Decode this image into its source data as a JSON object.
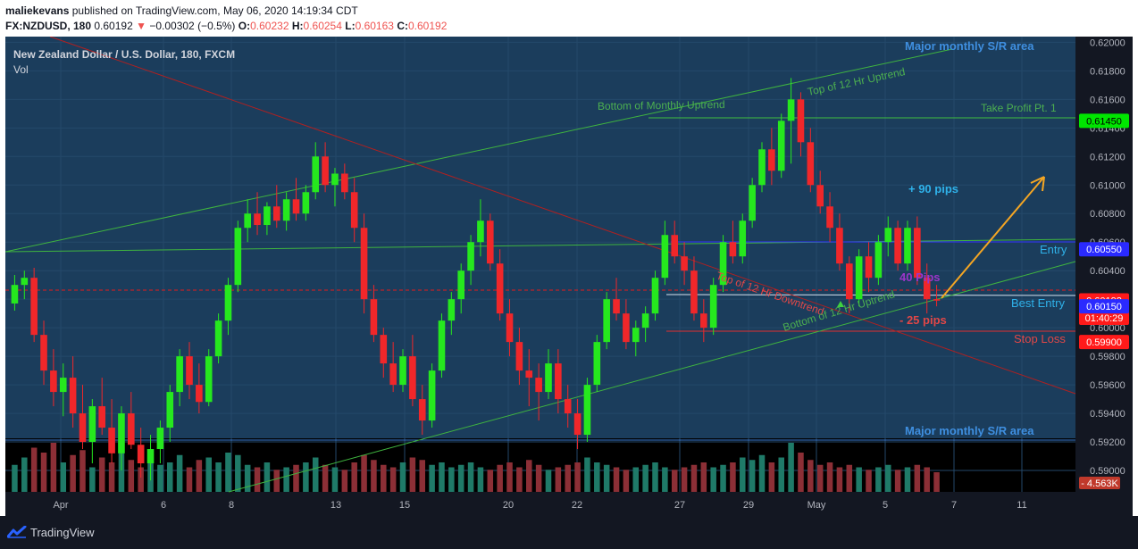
{
  "header": {
    "author": "maliekevans",
    "published_text": "published on TradingView.com, May 06, 2020 14:19:34 CDT",
    "symbol": "FX:NZDUSD, 180",
    "last": "0.60192",
    "arrow": "▼",
    "change": "−0.00302 (−0.5%)",
    "o_label": "O:",
    "o_value": "0.60232",
    "h_label": "H:",
    "h_value": "0.60254",
    "l_label": "L:",
    "l_value": "0.60163",
    "c_label": "C:",
    "c_value": "0.60192"
  },
  "legend": {
    "title": "New Zealand Dollar / U.S. Dollar, 180, FXCM",
    "vol": "Vol"
  },
  "footer": {
    "brand": "TradingView"
  },
  "chart_data": {
    "type": "candlestick",
    "title": "New Zealand Dollar / U.S. Dollar, 180, FXCM",
    "y_ticks": [
      "0.62000",
      "0.61800",
      "0.61600",
      "0.61400",
      "0.61200",
      "0.61000",
      "0.60800",
      "0.60600",
      "0.60400",
      "0.60200",
      "0.60000",
      "0.59800",
      "0.59600",
      "0.59400",
      "0.59200",
      "0.59000"
    ],
    "x_ticks": [
      "Apr",
      "6",
      "8",
      "13",
      "15",
      "20",
      "22",
      "27",
      "29",
      "May",
      "5",
      "7",
      "11"
    ],
    "ylim": [
      0.5885,
      0.6204
    ],
    "price_labels": [
      {
        "text": "0.61450",
        "value": 0.6145,
        "bg": "#00e600",
        "fg": "#000000"
      },
      {
        "text": "0.60550",
        "value": 0.6055,
        "bg": "#2a2aff",
        "fg": "#ffffff"
      },
      {
        "text": "0.60192",
        "value": 0.60192,
        "bg": "#ff1a1a",
        "fg": "#ffffff"
      },
      {
        "text": "01:40:29",
        "value": 0.6007,
        "bg": "#ff1a1a",
        "fg": "#ffffff"
      },
      {
        "text": "0.60150",
        "value": 0.6015,
        "bg": "#2a2aff",
        "fg": "#ffffff"
      },
      {
        "text": "0.59900",
        "value": 0.599,
        "bg": "#ff1a1a",
        "fg": "#ffffff"
      }
    ],
    "volume_label": "4.563K",
    "annotations": {
      "sr_top": "Major monthly S/R area",
      "sr_bottom": "Major monthly S/R area",
      "top_12hr": "Top of 12 Hr Uptrend",
      "bottom_monthly": "Bottom of Monthly Uptrend",
      "take_profit": "Take Profit Pt. 1",
      "plus_90": "+ 90 pips",
      "entry": "Entry",
      "pips40": "40 Pips",
      "top_downtrend": "Top of 12 Hr Downtrend",
      "bottom_12hr": "Bottom of 12 Hr Uptrend",
      "best_entry": "Best Entry",
      "minus_25": "- 25 pips",
      "stop_loss": "Stop Loss"
    },
    "levels": {
      "take_profit": 0.6145,
      "entry": 0.6055,
      "last": 0.60192,
      "best_entry": 0.6015,
      "stop_loss": 0.599,
      "sr_area_bottom": 0.5911
    },
    "candles": [
      [
        0.6017,
        0.6037,
        0.6012,
        0.603
      ],
      [
        0.603,
        0.604,
        0.602,
        0.6035
      ],
      [
        0.6035,
        0.6042,
        0.599,
        0.5995
      ],
      [
        0.5995,
        0.6005,
        0.596,
        0.597
      ],
      [
        0.597,
        0.5985,
        0.5945,
        0.5955
      ],
      [
        0.5955,
        0.5975,
        0.5938,
        0.5965
      ],
      [
        0.5965,
        0.598,
        0.593,
        0.594
      ],
      [
        0.594,
        0.596,
        0.5915,
        0.592
      ],
      [
        0.592,
        0.595,
        0.5905,
        0.5945
      ],
      [
        0.5945,
        0.5965,
        0.5925,
        0.593
      ],
      [
        0.593,
        0.595,
        0.5905,
        0.5912
      ],
      [
        0.5912,
        0.5945,
        0.59,
        0.594
      ],
      [
        0.594,
        0.5955,
        0.5915,
        0.5918
      ],
      [
        0.5918,
        0.593,
        0.5895,
        0.5905
      ],
      [
        0.5905,
        0.5925,
        0.5893,
        0.5915
      ],
      [
        0.5915,
        0.5935,
        0.5905,
        0.593
      ],
      [
        0.593,
        0.596,
        0.592,
        0.5955
      ],
      [
        0.5955,
        0.5985,
        0.5945,
        0.598
      ],
      [
        0.598,
        0.599,
        0.595,
        0.596
      ],
      [
        0.596,
        0.5975,
        0.594,
        0.5948
      ],
      [
        0.5948,
        0.5985,
        0.5945,
        0.598
      ],
      [
        0.598,
        0.601,
        0.5975,
        0.6005
      ],
      [
        0.6005,
        0.6035,
        0.5995,
        0.603
      ],
      [
        0.603,
        0.6075,
        0.6025,
        0.607
      ],
      [
        0.607,
        0.609,
        0.606,
        0.608
      ],
      [
        0.608,
        0.6095,
        0.6065,
        0.6072
      ],
      [
        0.6072,
        0.6088,
        0.6065,
        0.6085
      ],
      [
        0.6085,
        0.61,
        0.607,
        0.6075
      ],
      [
        0.6075,
        0.6095,
        0.6068,
        0.609
      ],
      [
        0.609,
        0.6105,
        0.6075,
        0.608
      ],
      [
        0.608,
        0.61,
        0.6075,
        0.6095
      ],
      [
        0.6095,
        0.613,
        0.609,
        0.612
      ],
      [
        0.612,
        0.613,
        0.6095,
        0.61
      ],
      [
        0.61,
        0.6112,
        0.6085,
        0.6108
      ],
      [
        0.6108,
        0.6115,
        0.609,
        0.6095
      ],
      [
        0.6095,
        0.6105,
        0.606,
        0.607
      ],
      [
        0.607,
        0.608,
        0.601,
        0.602
      ],
      [
        0.602,
        0.603,
        0.599,
        0.5995
      ],
      [
        0.5995,
        0.6,
        0.5965,
        0.5975
      ],
      [
        0.5975,
        0.599,
        0.5955,
        0.596
      ],
      [
        0.596,
        0.5985,
        0.5955,
        0.598
      ],
      [
        0.598,
        0.5995,
        0.5945,
        0.595
      ],
      [
        0.595,
        0.596,
        0.5925,
        0.5935
      ],
      [
        0.5935,
        0.5975,
        0.593,
        0.597
      ],
      [
        0.597,
        0.601,
        0.5965,
        0.6005
      ],
      [
        0.6005,
        0.6025,
        0.5995,
        0.602
      ],
      [
        0.602,
        0.6045,
        0.601,
        0.604
      ],
      [
        0.604,
        0.6065,
        0.603,
        0.606
      ],
      [
        0.606,
        0.609,
        0.605,
        0.6075
      ],
      [
        0.6075,
        0.608,
        0.604,
        0.6045
      ],
      [
        0.6045,
        0.6055,
        0.6005,
        0.601
      ],
      [
        0.601,
        0.602,
        0.598,
        0.599
      ],
      [
        0.599,
        0.6,
        0.596,
        0.597
      ],
      [
        0.597,
        0.5985,
        0.5945,
        0.5965
      ],
      [
        0.5965,
        0.5975,
        0.5935,
        0.5955
      ],
      [
        0.5955,
        0.5985,
        0.595,
        0.5975
      ],
      [
        0.5975,
        0.5985,
        0.594,
        0.595
      ],
      [
        0.595,
        0.596,
        0.593,
        0.594
      ],
      [
        0.594,
        0.595,
        0.5915,
        0.5925
      ],
      [
        0.5925,
        0.5965,
        0.592,
        0.596
      ],
      [
        0.596,
        0.5995,
        0.5955,
        0.599
      ],
      [
        0.599,
        0.6025,
        0.5985,
        0.602
      ],
      [
        0.602,
        0.6035,
        0.6005,
        0.601
      ],
      [
        0.601,
        0.602,
        0.5985,
        0.599
      ],
      [
        0.599,
        0.6005,
        0.598,
        0.6
      ],
      [
        0.6,
        0.6015,
        0.599,
        0.601
      ],
      [
        0.601,
        0.604,
        0.6005,
        0.6035
      ],
      [
        0.6035,
        0.6075,
        0.603,
        0.6065
      ],
      [
        0.6065,
        0.6075,
        0.6045,
        0.605
      ],
      [
        0.605,
        0.606,
        0.603,
        0.604
      ],
      [
        0.604,
        0.605,
        0.6005,
        0.601
      ],
      [
        0.601,
        0.602,
        0.599,
        0.6
      ],
      [
        0.6,
        0.6035,
        0.5995,
        0.603
      ],
      [
        0.603,
        0.6065,
        0.6025,
        0.606
      ],
      [
        0.606,
        0.6075,
        0.6045,
        0.605
      ],
      [
        0.605,
        0.608,
        0.6045,
        0.6075
      ],
      [
        0.6075,
        0.6105,
        0.607,
        0.61
      ],
      [
        0.61,
        0.613,
        0.6095,
        0.6125
      ],
      [
        0.6125,
        0.614,
        0.61,
        0.611
      ],
      [
        0.611,
        0.615,
        0.6105,
        0.6145
      ],
      [
        0.6145,
        0.6175,
        0.6115,
        0.616
      ],
      [
        0.616,
        0.6165,
        0.612,
        0.613
      ],
      [
        0.613,
        0.614,
        0.6095,
        0.61
      ],
      [
        0.61,
        0.611,
        0.608,
        0.6085
      ],
      [
        0.6085,
        0.6095,
        0.606,
        0.607
      ],
      [
        0.607,
        0.608,
        0.604,
        0.6045
      ],
      [
        0.6045,
        0.605,
        0.601,
        0.602
      ],
      [
        0.602,
        0.6055,
        0.6015,
        0.605
      ],
      [
        0.605,
        0.606,
        0.6025,
        0.6035
      ],
      [
        0.6035,
        0.6065,
        0.603,
        0.606
      ],
      [
        0.606,
        0.6078,
        0.605,
        0.607
      ],
      [
        0.607,
        0.6075,
        0.604,
        0.6045
      ],
      [
        0.6045,
        0.6075,
        0.604,
        0.607
      ],
      [
        0.607,
        0.6078,
        0.603,
        0.6035
      ],
      [
        0.6035,
        0.6045,
        0.601,
        0.602
      ],
      [
        0.602,
        0.603,
        0.6015,
        0.6019
      ]
    ],
    "volumes": [
      0.55,
      0.7,
      0.9,
      0.8,
      1.0,
      0.6,
      0.75,
      0.85,
      0.5,
      0.7,
      0.6,
      0.8,
      0.65,
      0.5,
      0.7,
      0.55,
      0.6,
      0.75,
      0.5,
      0.65,
      0.7,
      0.6,
      0.8,
      0.75,
      0.55,
      0.5,
      0.6,
      0.45,
      0.5,
      0.55,
      0.6,
      0.7,
      0.55,
      0.5,
      0.45,
      0.6,
      0.75,
      0.65,
      0.55,
      0.5,
      0.6,
      0.7,
      0.65,
      0.55,
      0.6,
      0.5,
      0.55,
      0.6,
      0.5,
      0.45,
      0.55,
      0.6,
      0.5,
      0.65,
      0.55,
      0.45,
      0.5,
      0.55,
      0.6,
      0.7,
      0.6,
      0.55,
      0.5,
      0.45,
      0.5,
      0.55,
      0.6,
      0.5,
      0.45,
      0.5,
      0.55,
      0.6,
      0.5,
      0.55,
      0.6,
      0.7,
      0.65,
      0.75,
      0.6,
      0.7,
      1.0,
      0.8,
      0.65,
      0.55,
      0.6,
      0.5,
      0.55,
      0.5,
      0.45,
      0.5,
      0.55,
      0.45,
      0.5,
      0.55,
      0.5,
      0.4
    ]
  }
}
